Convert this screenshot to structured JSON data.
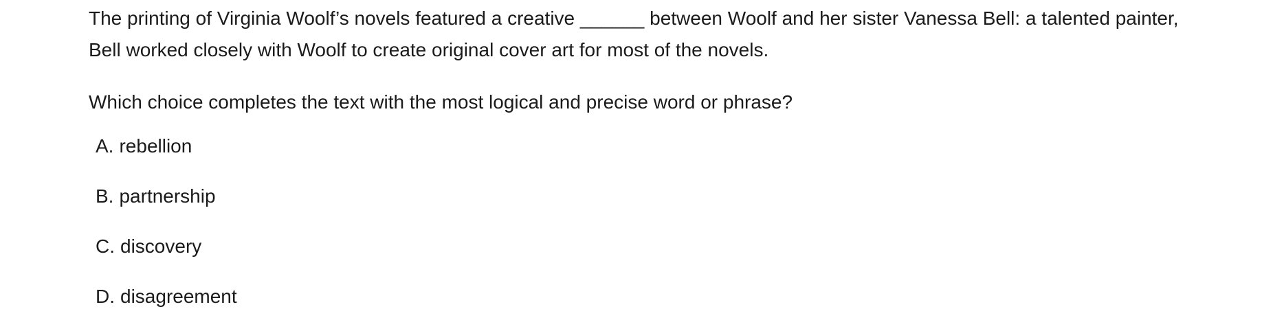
{
  "passage": {
    "before": "The printing of Virginia Woolf’s novels featured a creative",
    "blank": "______",
    "after": "between Woolf and her sister Vanessa Bell: a talented painter, Bell worked closely with Woolf to create original cover art for most of the novels."
  },
  "question": "Which choice completes the text with the most logical and precise word or phrase?",
  "choices": [
    {
      "letter": "A.",
      "text": "rebellion"
    },
    {
      "letter": "B.",
      "text": "partnership"
    },
    {
      "letter": "C.",
      "text": "discovery"
    },
    {
      "letter": "D.",
      "text": "disagreement"
    }
  ]
}
